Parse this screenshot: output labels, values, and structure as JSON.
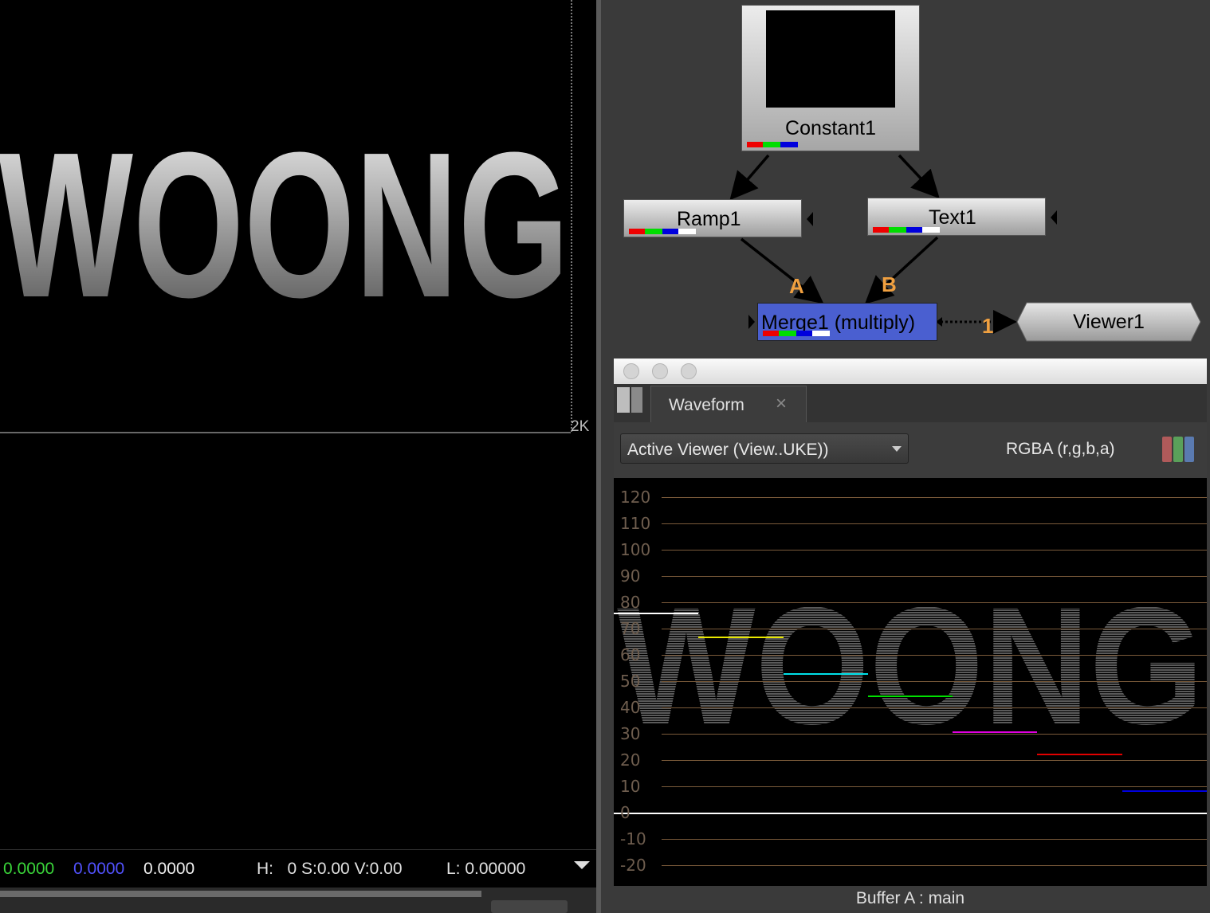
{
  "viewer": {
    "image_text": "WOONG",
    "format_label": "2K",
    "readout": {
      "g": "0.0000",
      "b": "0.0000",
      "a": "0.0000",
      "hsv": "H:   0 S:0.00 V:0.00",
      "lum": "L: 0.00000"
    }
  },
  "graph": {
    "nodes": {
      "constant": "Constant1",
      "ramp": "Ramp1",
      "text": "Text1",
      "merge": "Merge1 (multiply)",
      "viewer": "Viewer1"
    },
    "input_a": "A",
    "input_b": "B",
    "viewer_input": "1",
    "colors": {
      "merge_fill": "#4a5fd0",
      "input_label": "#f0a040",
      "node_fill": "#c8c8c8"
    }
  },
  "scope": {
    "tab_label": "Waveform",
    "close_glyph": "×",
    "source_select": "Active Viewer (View..UKE))",
    "channels": "RGBA (r,g,b,a)",
    "y_labels": [
      "120",
      "110",
      "100",
      "90",
      "80",
      "70",
      "60",
      "50",
      "40",
      "30",
      "20",
      "10",
      "0",
      "-10",
      "-20"
    ],
    "overlay_text": "WOONG",
    "status": "Buffer A : main",
    "trace_colors": [
      "#ffffff",
      "#e8e800",
      "#00e0e8",
      "#00e000",
      "#e000e0",
      "#e00000",
      "#0000e0"
    ]
  }
}
